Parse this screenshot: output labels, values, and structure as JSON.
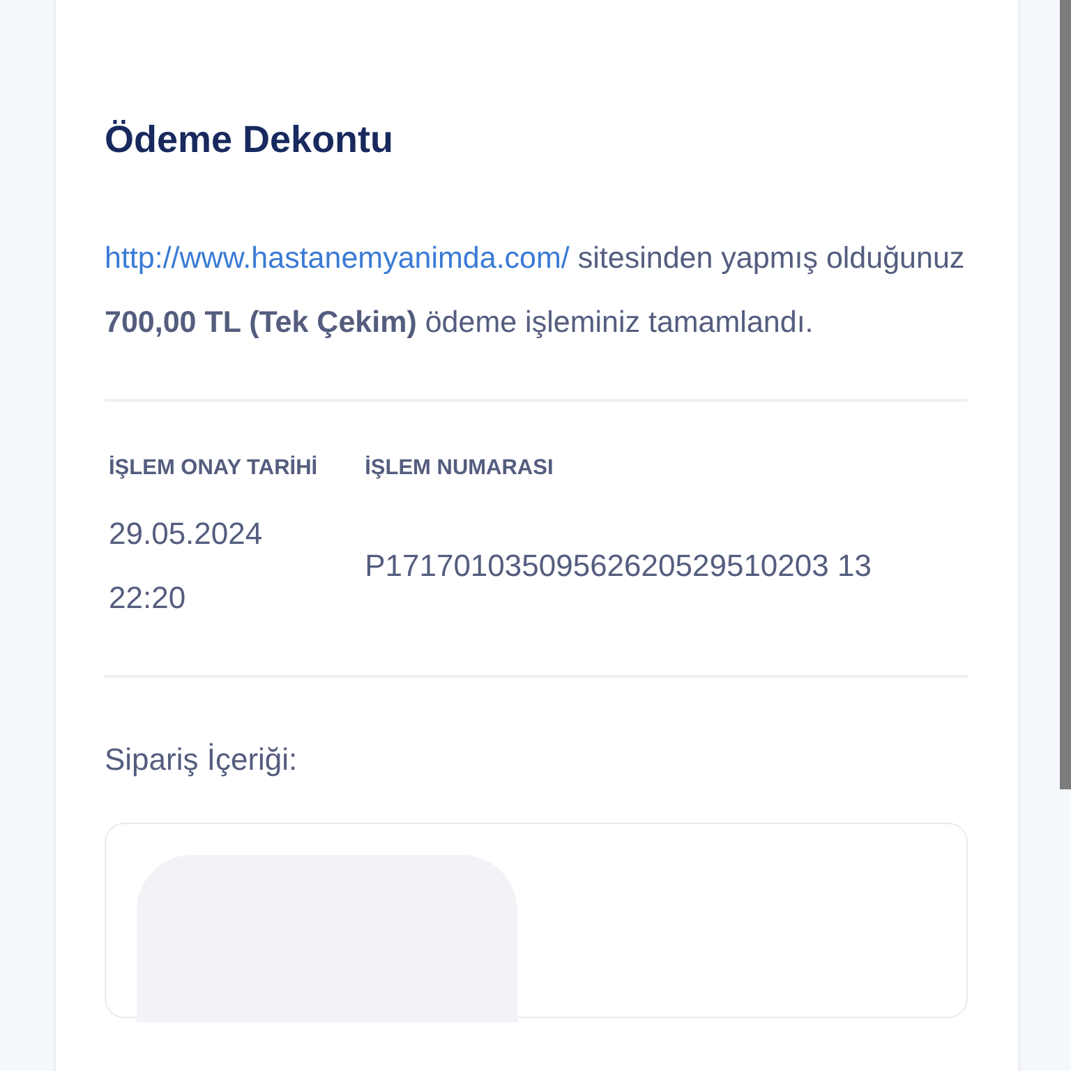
{
  "receipt": {
    "title": "Ödeme Dekontu",
    "message": {
      "link": "http://www.hastanemyanimda.com/",
      "text": "sitesinden yapmış olduğunuz **700,00 TL (Tek Çekim)** ödeme işleminiz tamamlandı."
    },
    "details": [
      {
        "label": "İŞLEM ONAY TARİHİ",
        "lines": [
          "29.05.2024",
          "22:20"
        ]
      },
      {
        "label": "İŞLEM NUMARASI",
        "lines": [
          "P17170103509562620529510203 13"
        ]
      }
    ],
    "order_heading": "Sipariş İçeriği:"
  }
}
